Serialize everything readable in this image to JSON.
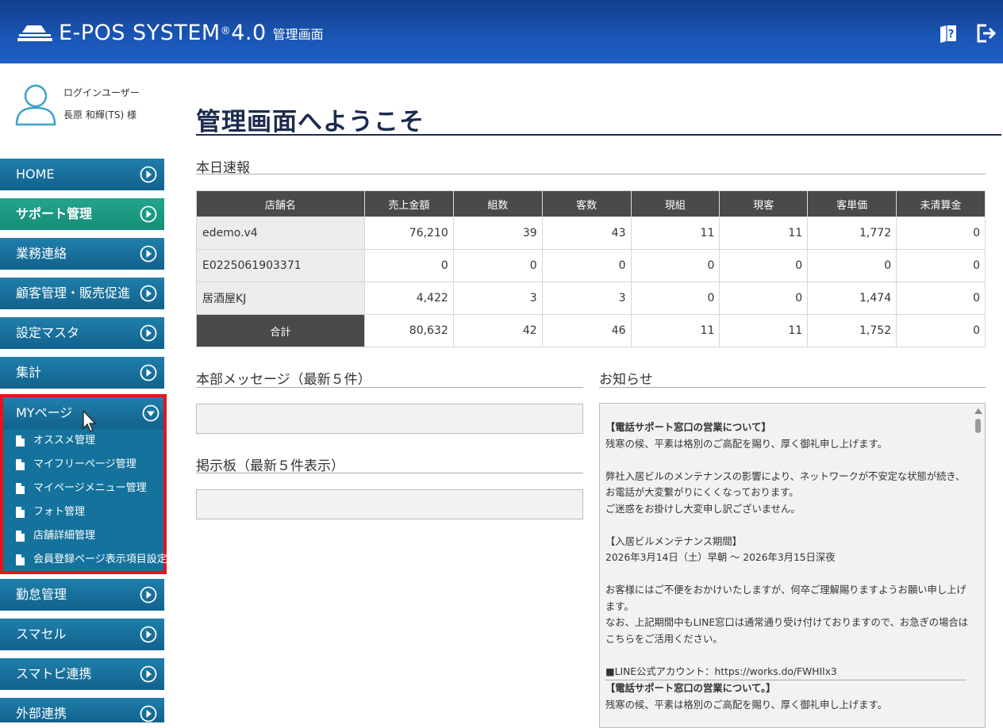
{
  "header": {
    "logo_text": "E-POS SYSTEM",
    "logo_reg": "®",
    "logo_version": "4.0",
    "logo_sub": "管理画面"
  },
  "user": {
    "label": "ログインユーザー",
    "name": "長原 和輝(TS) 様"
  },
  "sidebar": {
    "items": [
      {
        "label": "HOME"
      },
      {
        "label": "サポート管理"
      },
      {
        "label": "業務連絡"
      },
      {
        "label": "顧客管理・販売促進"
      },
      {
        "label": "設定マスタ"
      },
      {
        "label": "集計"
      }
    ],
    "mypage": {
      "label": "MYページ",
      "children": [
        {
          "label": "オススメ管理"
        },
        {
          "label": "マイフリーページ管理"
        },
        {
          "label": "マイページメニュー管理"
        },
        {
          "label": "フォト管理"
        },
        {
          "label": "店舗詳細管理"
        },
        {
          "label": "会員登録ページ表示項目設定"
        }
      ]
    },
    "items_after": [
      {
        "label": "勤怠管理"
      },
      {
        "label": "スマセル"
      },
      {
        "label": "スマトピ連携"
      },
      {
        "label": "外部連携"
      }
    ]
  },
  "main": {
    "title": "管理画面へようこそ",
    "today_title": "本日速報",
    "table": {
      "headers": [
        "店舗名",
        "売上金額",
        "組数",
        "客数",
        "現組",
        "現客",
        "客単価",
        "未清算金"
      ],
      "rows": [
        [
          "edemo.v4",
          "76,210",
          "39",
          "43",
          "11",
          "11",
          "1,772",
          "0"
        ],
        [
          "E0225061903371",
          "0",
          "0",
          "0",
          "0",
          "0",
          "0",
          "0"
        ],
        [
          "居酒屋KJ",
          "4,422",
          "3",
          "3",
          "0",
          "0",
          "1,474",
          "0"
        ]
      ],
      "total": [
        "合計",
        "80,632",
        "42",
        "46",
        "11",
        "11",
        "1,752",
        "0"
      ]
    },
    "hq_message_title": "本部メッセージ（最新５件）",
    "board_title": "掲示板（最新５件表示）",
    "notice_title": "お知らせ",
    "notice_lines": [
      {
        "text": "【電話サポート窓口の営業について】",
        "bold": true
      },
      {
        "text": "残寒の候、平素は格別のご高配を賜り、厚く御礼申し上げます。"
      },
      {
        "text": ""
      },
      {
        "text": "弊社入居ビルのメンテナンスの影響により、ネットワークが不安定な状態が続き、"
      },
      {
        "text": "お電話が大変繋がりにくくなっております。"
      },
      {
        "text": "ご迷惑をお掛けし大変申し訳ございません。"
      },
      {
        "text": ""
      },
      {
        "text": "【入居ビルメンテナンス期間】"
      },
      {
        "text": "2026年3月14日（土）早朝 ～ 2026年3月15日深夜"
      },
      {
        "text": ""
      },
      {
        "text": "お客様にはご不便をおかけいたしますが、何卒ご理解賜りますようお願い申し上げ"
      },
      {
        "text": "ます。"
      },
      {
        "text": "なお、上記期間中もLINE窓口は通常通り受け付けておりますので、お急ぎの場合は"
      },
      {
        "text": "こちらをご活用ください。"
      },
      {
        "text": ""
      },
      {
        "text": "■LINE公式アカウント：https://works.do/FWHIlx3"
      },
      {
        "text": "【電話サポート窓口の営業について。】",
        "bold": true,
        "sep": true
      },
      {
        "text": "残寒の候、平素は格別のご高配を賜り、厚く御礼申し上げます。"
      }
    ]
  }
}
